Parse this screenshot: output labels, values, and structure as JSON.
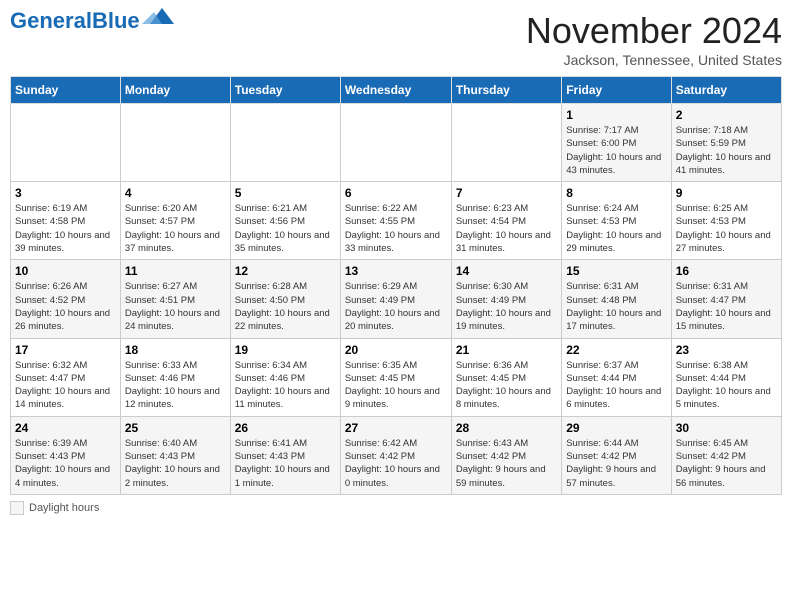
{
  "header": {
    "logo_general": "General",
    "logo_blue": "Blue",
    "month_title": "November 2024",
    "location": "Jackson, Tennessee, United States"
  },
  "legend": {
    "label": "Daylight hours"
  },
  "days_of_week": [
    "Sunday",
    "Monday",
    "Tuesday",
    "Wednesday",
    "Thursday",
    "Friday",
    "Saturday"
  ],
  "weeks": [
    [
      {
        "day": "",
        "info": ""
      },
      {
        "day": "",
        "info": ""
      },
      {
        "day": "",
        "info": ""
      },
      {
        "day": "",
        "info": ""
      },
      {
        "day": "",
        "info": ""
      },
      {
        "day": "1",
        "info": "Sunrise: 7:17 AM\nSunset: 6:00 PM\nDaylight: 10 hours and 43 minutes."
      },
      {
        "day": "2",
        "info": "Sunrise: 7:18 AM\nSunset: 5:59 PM\nDaylight: 10 hours and 41 minutes."
      }
    ],
    [
      {
        "day": "3",
        "info": "Sunrise: 6:19 AM\nSunset: 4:58 PM\nDaylight: 10 hours and 39 minutes."
      },
      {
        "day": "4",
        "info": "Sunrise: 6:20 AM\nSunset: 4:57 PM\nDaylight: 10 hours and 37 minutes."
      },
      {
        "day": "5",
        "info": "Sunrise: 6:21 AM\nSunset: 4:56 PM\nDaylight: 10 hours and 35 minutes."
      },
      {
        "day": "6",
        "info": "Sunrise: 6:22 AM\nSunset: 4:55 PM\nDaylight: 10 hours and 33 minutes."
      },
      {
        "day": "7",
        "info": "Sunrise: 6:23 AM\nSunset: 4:54 PM\nDaylight: 10 hours and 31 minutes."
      },
      {
        "day": "8",
        "info": "Sunrise: 6:24 AM\nSunset: 4:53 PM\nDaylight: 10 hours and 29 minutes."
      },
      {
        "day": "9",
        "info": "Sunrise: 6:25 AM\nSunset: 4:53 PM\nDaylight: 10 hours and 27 minutes."
      }
    ],
    [
      {
        "day": "10",
        "info": "Sunrise: 6:26 AM\nSunset: 4:52 PM\nDaylight: 10 hours and 26 minutes."
      },
      {
        "day": "11",
        "info": "Sunrise: 6:27 AM\nSunset: 4:51 PM\nDaylight: 10 hours and 24 minutes."
      },
      {
        "day": "12",
        "info": "Sunrise: 6:28 AM\nSunset: 4:50 PM\nDaylight: 10 hours and 22 minutes."
      },
      {
        "day": "13",
        "info": "Sunrise: 6:29 AM\nSunset: 4:49 PM\nDaylight: 10 hours and 20 minutes."
      },
      {
        "day": "14",
        "info": "Sunrise: 6:30 AM\nSunset: 4:49 PM\nDaylight: 10 hours and 19 minutes."
      },
      {
        "day": "15",
        "info": "Sunrise: 6:31 AM\nSunset: 4:48 PM\nDaylight: 10 hours and 17 minutes."
      },
      {
        "day": "16",
        "info": "Sunrise: 6:31 AM\nSunset: 4:47 PM\nDaylight: 10 hours and 15 minutes."
      }
    ],
    [
      {
        "day": "17",
        "info": "Sunrise: 6:32 AM\nSunset: 4:47 PM\nDaylight: 10 hours and 14 minutes."
      },
      {
        "day": "18",
        "info": "Sunrise: 6:33 AM\nSunset: 4:46 PM\nDaylight: 10 hours and 12 minutes."
      },
      {
        "day": "19",
        "info": "Sunrise: 6:34 AM\nSunset: 4:46 PM\nDaylight: 10 hours and 11 minutes."
      },
      {
        "day": "20",
        "info": "Sunrise: 6:35 AM\nSunset: 4:45 PM\nDaylight: 10 hours and 9 minutes."
      },
      {
        "day": "21",
        "info": "Sunrise: 6:36 AM\nSunset: 4:45 PM\nDaylight: 10 hours and 8 minutes."
      },
      {
        "day": "22",
        "info": "Sunrise: 6:37 AM\nSunset: 4:44 PM\nDaylight: 10 hours and 6 minutes."
      },
      {
        "day": "23",
        "info": "Sunrise: 6:38 AM\nSunset: 4:44 PM\nDaylight: 10 hours and 5 minutes."
      }
    ],
    [
      {
        "day": "24",
        "info": "Sunrise: 6:39 AM\nSunset: 4:43 PM\nDaylight: 10 hours and 4 minutes."
      },
      {
        "day": "25",
        "info": "Sunrise: 6:40 AM\nSunset: 4:43 PM\nDaylight: 10 hours and 2 minutes."
      },
      {
        "day": "26",
        "info": "Sunrise: 6:41 AM\nSunset: 4:43 PM\nDaylight: 10 hours and 1 minute."
      },
      {
        "day": "27",
        "info": "Sunrise: 6:42 AM\nSunset: 4:42 PM\nDaylight: 10 hours and 0 minutes."
      },
      {
        "day": "28",
        "info": "Sunrise: 6:43 AM\nSunset: 4:42 PM\nDaylight: 9 hours and 59 minutes."
      },
      {
        "day": "29",
        "info": "Sunrise: 6:44 AM\nSunset: 4:42 PM\nDaylight: 9 hours and 57 minutes."
      },
      {
        "day": "30",
        "info": "Sunrise: 6:45 AM\nSunset: 4:42 PM\nDaylight: 9 hours and 56 minutes."
      }
    ]
  ]
}
